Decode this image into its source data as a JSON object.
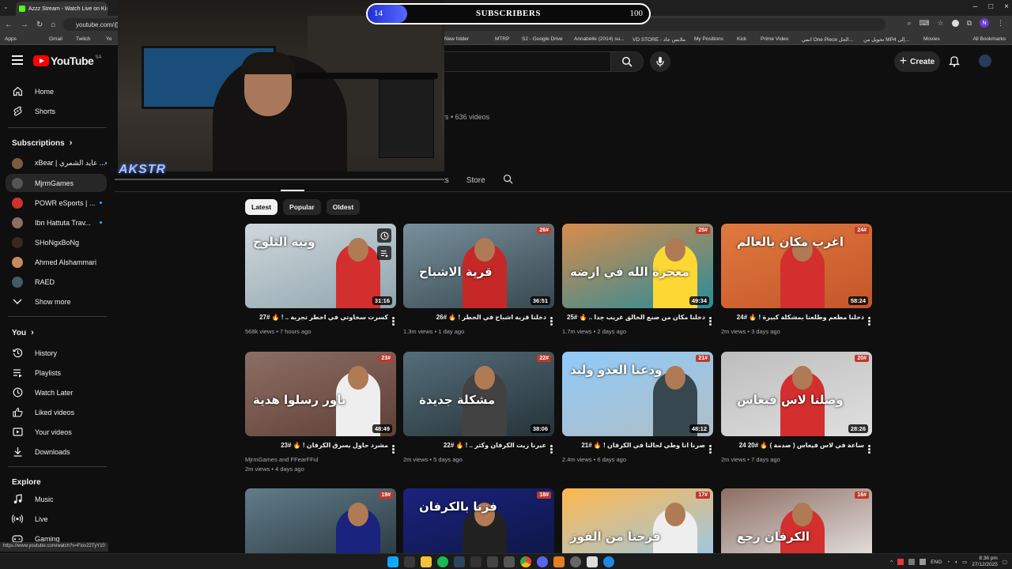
{
  "browser": {
    "tab_title": "Azzz Stream - Watch Live on Ki",
    "url": "youtube.com/@",
    "bookmarks": [
      "Apps",
      "Gmail",
      "Twitch",
      "Yo",
      "New folder",
      "MTRP",
      "S2 - Google Drive",
      "Annabelle (2014) su...",
      "VD STORE - ملابس جاد",
      "My Positions",
      "Kick",
      "Prime Video",
      "انمي One Piece الحل...",
      "تحويل من MP4 إلى...",
      "Movies"
    ],
    "all_bookmarks": "All Bookmarks",
    "status_url": "https://www.youtube.com/watch?v=Fiov22TyY10"
  },
  "header": {
    "logo_text": "YouTube",
    "country_code": "SA",
    "create_label": "Create"
  },
  "sidebar": {
    "home": "Home",
    "shorts": "Shorts",
    "subscriptions_title": "Subscriptions",
    "subscriptions": [
      {
        "name": "xBear | عايد الشمري ...",
        "color": "#7a5c3a",
        "live": true
      },
      {
        "name": "MjrmGames",
        "color": "#555555",
        "live": false
      },
      {
        "name": "POWR eSports | ...",
        "color": "#d32f2f",
        "live": true
      },
      {
        "name": "Ibn Hattuta Trav...",
        "color": "#8d6e63",
        "live": true
      },
      {
        "name": "SHoNgxBoNg",
        "color": "#3e2723",
        "live": false
      },
      {
        "name": "Ahmed Alshammari",
        "color": "#c58c5a",
        "live": false
      },
      {
        "name": "RAED",
        "color": "#455a64",
        "live": false
      }
    ],
    "show_more": "Show more",
    "you_title": "You",
    "you_items": [
      "History",
      "Playlists",
      "Watch Later",
      "Liked videos",
      "Your videos",
      "Downloads"
    ],
    "explore_title": "Explore",
    "explore_items": [
      "Music",
      "Live",
      "Gaming"
    ]
  },
  "channel": {
    "meta": "rs • 636 videos",
    "tabs_partial": "ts",
    "store_tab": "Store"
  },
  "chips": [
    "Latest",
    "Popular",
    "Oldest"
  ],
  "videos": [
    {
      "title": "كسرت سخاوتي في اخطر تجربة .. ! 🔥 #27",
      "views": "568k views",
      "age": "7 hours ago",
      "duration": "31:16",
      "episode": "",
      "bg": "#cfd8dc",
      "bg2": "#90a4ae",
      "shirt": "#d32f2f",
      "text": "ونيه الثلوج"
    },
    {
      "title": "دخلنا قرية اشباح في الخطر ! 🔥 #26",
      "views": "1.3m views",
      "age": "1 day ago",
      "duration": "36:51",
      "episode": "26#",
      "bg": "#78909c",
      "bg2": "#37474f",
      "shirt": "#c62828",
      "text": "قرية الاشباح"
    },
    {
      "title": "دخلنا مكان من صنع الخالق غريب جدا .. 🔥 #25",
      "views": "1.7m views",
      "age": "2 days ago",
      "duration": "49:34",
      "episode": "25#",
      "bg": "#d98c4a",
      "bg2": "#2a8c9a",
      "shirt": "#fdd835",
      "text": "معجزة الله في ارضه"
    },
    {
      "title": "دخلنا مطعم وطلعنا بمشكلة كبيرة ! 🔥 #24",
      "views": "2m views",
      "age": "3 days ago",
      "duration": "58:24",
      "episode": "24#",
      "bg": "#e07a3e",
      "bg2": "#c4552a",
      "shirt": "#d32f2f",
      "text": "اغرب مكان بالعالم"
    },
    {
      "title": "مشرد حاول يسرق الكرفان ! 🔥 #23",
      "views": "2m views",
      "age": "4 days ago",
      "duration": "48:49",
      "episode": "23#",
      "bg": "#8d6e63",
      "bg2": "#5d4037",
      "shirt": "#eeeeee",
      "text": "باور رسلوا هدية",
      "channel_line": "MjrmGames and FFearFFul"
    },
    {
      "title": "عيرنا زيت الكرفان وكثر .. ! 🔥 #22",
      "views": "2m views",
      "age": "5 days ago",
      "duration": "38:06",
      "episode": "22#",
      "bg": "#546e7a",
      "bg2": "#263238",
      "shirt": "#424242",
      "text": "مشكلة جديدة"
    },
    {
      "title": "صرنا انا وطي لحالنا في الكرفان ! 🔥 #21",
      "views": "2.4m views",
      "age": "6 days ago",
      "duration": "48:12",
      "episode": "21#",
      "bg": "#90caf9",
      "bg2": "#b0bec5",
      "shirt": "#37474f",
      "text": "ودعنا العدو وليد"
    },
    {
      "title": "ساعة في لاس فيغاس ( صدمة ) 🔥 #20 24",
      "views": "2m views",
      "age": "7 days ago",
      "duration": "28:26",
      "episode": "20#",
      "bg": "#bdbdbd",
      "bg2": "#e0e0e0",
      "shirt": "#d32f2f",
      "text": "وصلنا لاس فيغاس"
    },
    {
      "title": "",
      "views": "",
      "age": "",
      "duration": "",
      "episode": "19#",
      "bg": "#607d8b",
      "bg2": "#263238",
      "shirt": "#1a237e",
      "text": ""
    },
    {
      "title": "",
      "views": "",
      "age": "",
      "duration": "",
      "episode": "18#",
      "bg": "#1a237e",
      "bg2": "#0d1440",
      "shirt": "#212121",
      "text": "فزنا بالكرفان"
    },
    {
      "title": "",
      "views": "",
      "age": "",
      "duration": "",
      "episode": "17#",
      "bg": "#ffb74d",
      "bg2": "#90caf9",
      "shirt": "#eeeeee",
      "text": "فرحنا من الفوز"
    },
    {
      "title": "",
      "views": "",
      "age": "",
      "duration": "",
      "episode": "16#",
      "bg": "#8d6e63",
      "bg2": "#eeeeee",
      "shirt": "#d32f2f",
      "text": "الكرفان رجع"
    }
  ],
  "stream_overlay": {
    "subs_current": "14",
    "subs_label": "SUBSCRIBERS",
    "subs_goal": "100",
    "subs_progress": 0.14,
    "logo_text": "AKSTR"
  },
  "taskbar": {
    "lang": "ENG",
    "time": "8:36 pm",
    "date": "27/12/2025"
  },
  "colors": {
    "accent": "#ff0000",
    "progress": "#3a49f0",
    "live": "#3ea6ff"
  }
}
